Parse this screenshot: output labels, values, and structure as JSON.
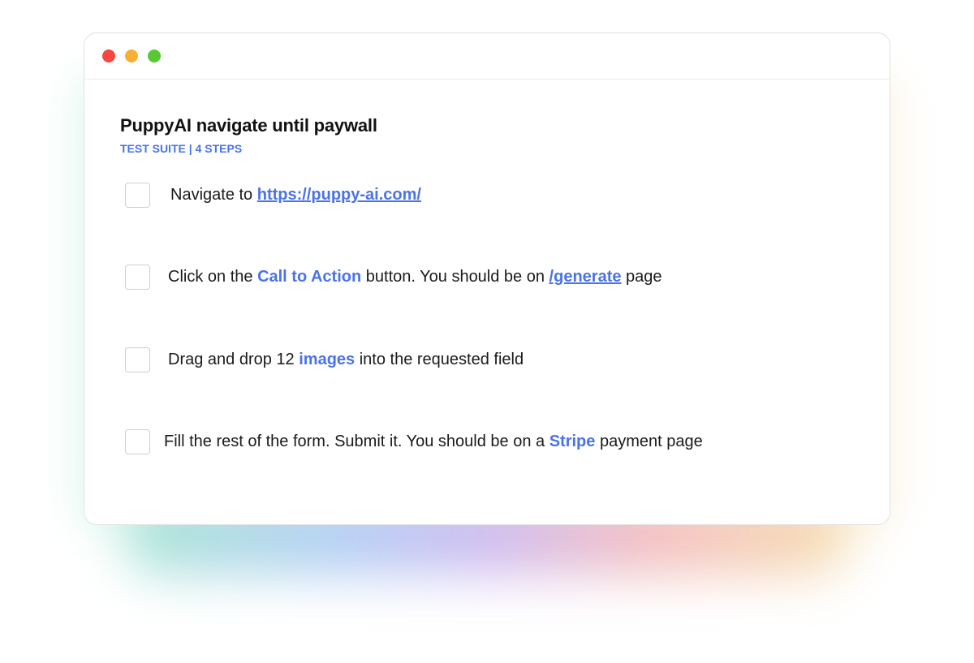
{
  "window": {
    "controls": [
      {
        "name": "close",
        "color": "#f4473f"
      },
      {
        "name": "minimize",
        "color": "#f7b035"
      },
      {
        "name": "maximize",
        "color": "#58c834"
      }
    ]
  },
  "suite": {
    "title": "PuppyAI navigate until paywall",
    "subtitle": "TEST SUITE | 4 STEPS"
  },
  "steps": [
    {
      "checked": false,
      "parts": [
        {
          "text": "Navigate to "
        },
        {
          "text": "https://puppy-ai.com/",
          "style": "link"
        }
      ]
    },
    {
      "checked": false,
      "parts": [
        {
          "text": "Click on the "
        },
        {
          "text": "Call to Action",
          "style": "highlight"
        },
        {
          "text": " button. You should be on "
        },
        {
          "text": "/generate",
          "style": "link"
        },
        {
          "text": " page"
        }
      ]
    },
    {
      "checked": false,
      "parts": [
        {
          "text": "Drag and drop 12 "
        },
        {
          "text": "images",
          "style": "highlight"
        },
        {
          "text": " into the requested field"
        }
      ]
    },
    {
      "checked": false,
      "parts": [
        {
          "text": "Fill the rest of the form. Submit it. You should be on a "
        },
        {
          "text": "Stripe",
          "style": "highlight"
        },
        {
          "text": " payment page"
        }
      ]
    }
  ],
  "colors": {
    "accent": "#4a73e8",
    "title": "#111111",
    "text": "#1a1a1a"
  }
}
